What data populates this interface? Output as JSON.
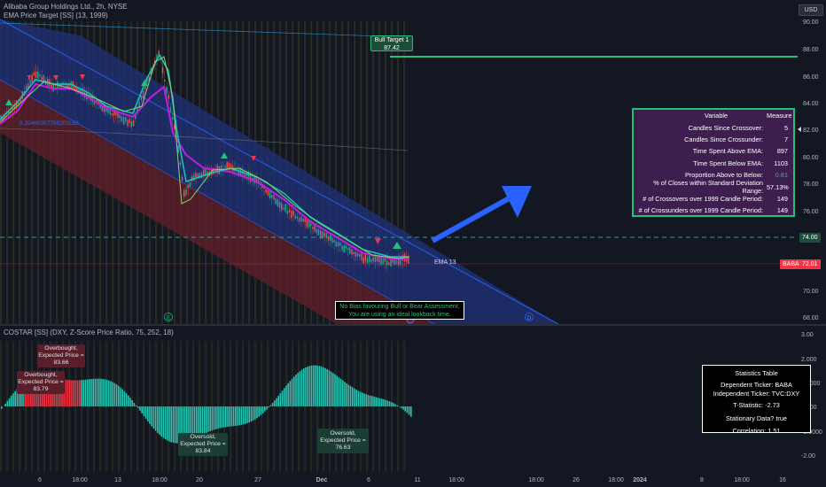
{
  "legend": {
    "symbol": "Alibaba Group Holdings Ltd., 2h, NYSE",
    "indicator": "EMA Price Target [SS] (13, 1999)",
    "lower_indicator": "COSTAR [SS] (DXY, Z-Score Price Ratio, 75, 252, 18)"
  },
  "currency": "USD",
  "price_axis": [
    "90.00",
    "88.00",
    "86.00",
    "84.00",
    "82.00",
    "80.00",
    "78.00",
    "76.00",
    "74.00",
    "72.00",
    "70.00",
    "68.00"
  ],
  "lower_axis": [
    "3.00",
    "2.000",
    "1.0000",
    "0.000",
    "-1.0000",
    "-2.00"
  ],
  "time_axis": [
    "6",
    "18:00",
    "13",
    "18:00",
    "20",
    "27",
    "Dec",
    "6",
    "11",
    "18:00",
    "18:00",
    "26",
    "18:00",
    "2024",
    "8",
    "18:00",
    "16"
  ],
  "badges": {
    "level_price": "74.00",
    "ticker": "BABA",
    "last_price": "72.01"
  },
  "labels": {
    "bull_target_title": "Bull Target 1",
    "bull_target_value": "87.42",
    "ema_label": "EMA 13",
    "channel_label": "0.35460357795205165",
    "marker_e": "E",
    "marker_d": "D",
    "bias_line1": "No Bias favouring Bull or Bear Assessment.",
    "bias_line2": "You are using an ideal lookback time."
  },
  "variable_table": {
    "header_variable": "Variable",
    "header_measure": "Measure",
    "rows": [
      {
        "label": "Candles Since Crossover:",
        "value": "5"
      },
      {
        "label": "Candles Since Crossunder:",
        "value": "7"
      },
      {
        "label": "Time Spent Above EMA:",
        "value": "897"
      },
      {
        "label": "Time Spent Below EMA:",
        "value": "1103"
      },
      {
        "label": "Proportion Above to Below:",
        "value": "0.81"
      },
      {
        "label": "% of Closes within Standard Deviation Range:",
        "value": "57.13%"
      },
      {
        "label": "# of Crossovers over 1999 Candle Period:",
        "value": "149"
      },
      {
        "label": "# of Crossunders over 1999 Candle Period:",
        "value": "149"
      }
    ]
  },
  "stats_table": {
    "title": "Statistics Table",
    "dependent": "Dependent Ticker: BABA",
    "independent": "Independent Ticker: TVC:DXY",
    "t_stat": "T-Statistic: -2.73",
    "stationary": "Stationary Data? true",
    "correlation": "Correlation: 1.51"
  },
  "callouts": {
    "overbought1": {
      "l1": "Overbought,",
      "l2": "Expected Price =",
      "l3": "83.66"
    },
    "overbought2": {
      "l1": "Overbought,",
      "l2": "Expected Price =",
      "l3": "83.79"
    },
    "oversold1": {
      "l1": "Oversold,",
      "l2": "Expected Price =",
      "l3": "83.84"
    },
    "oversold2": {
      "l1": "Oversold,",
      "l2": "Expected Price =",
      "l3": "76.63"
    }
  },
  "colors": {
    "background": "#131722",
    "bull": "#23c07a",
    "bear": "#f23645",
    "teal": "#26a69a",
    "purple_panel": "#3d1e4f",
    "arrow": "#2962ff"
  }
}
